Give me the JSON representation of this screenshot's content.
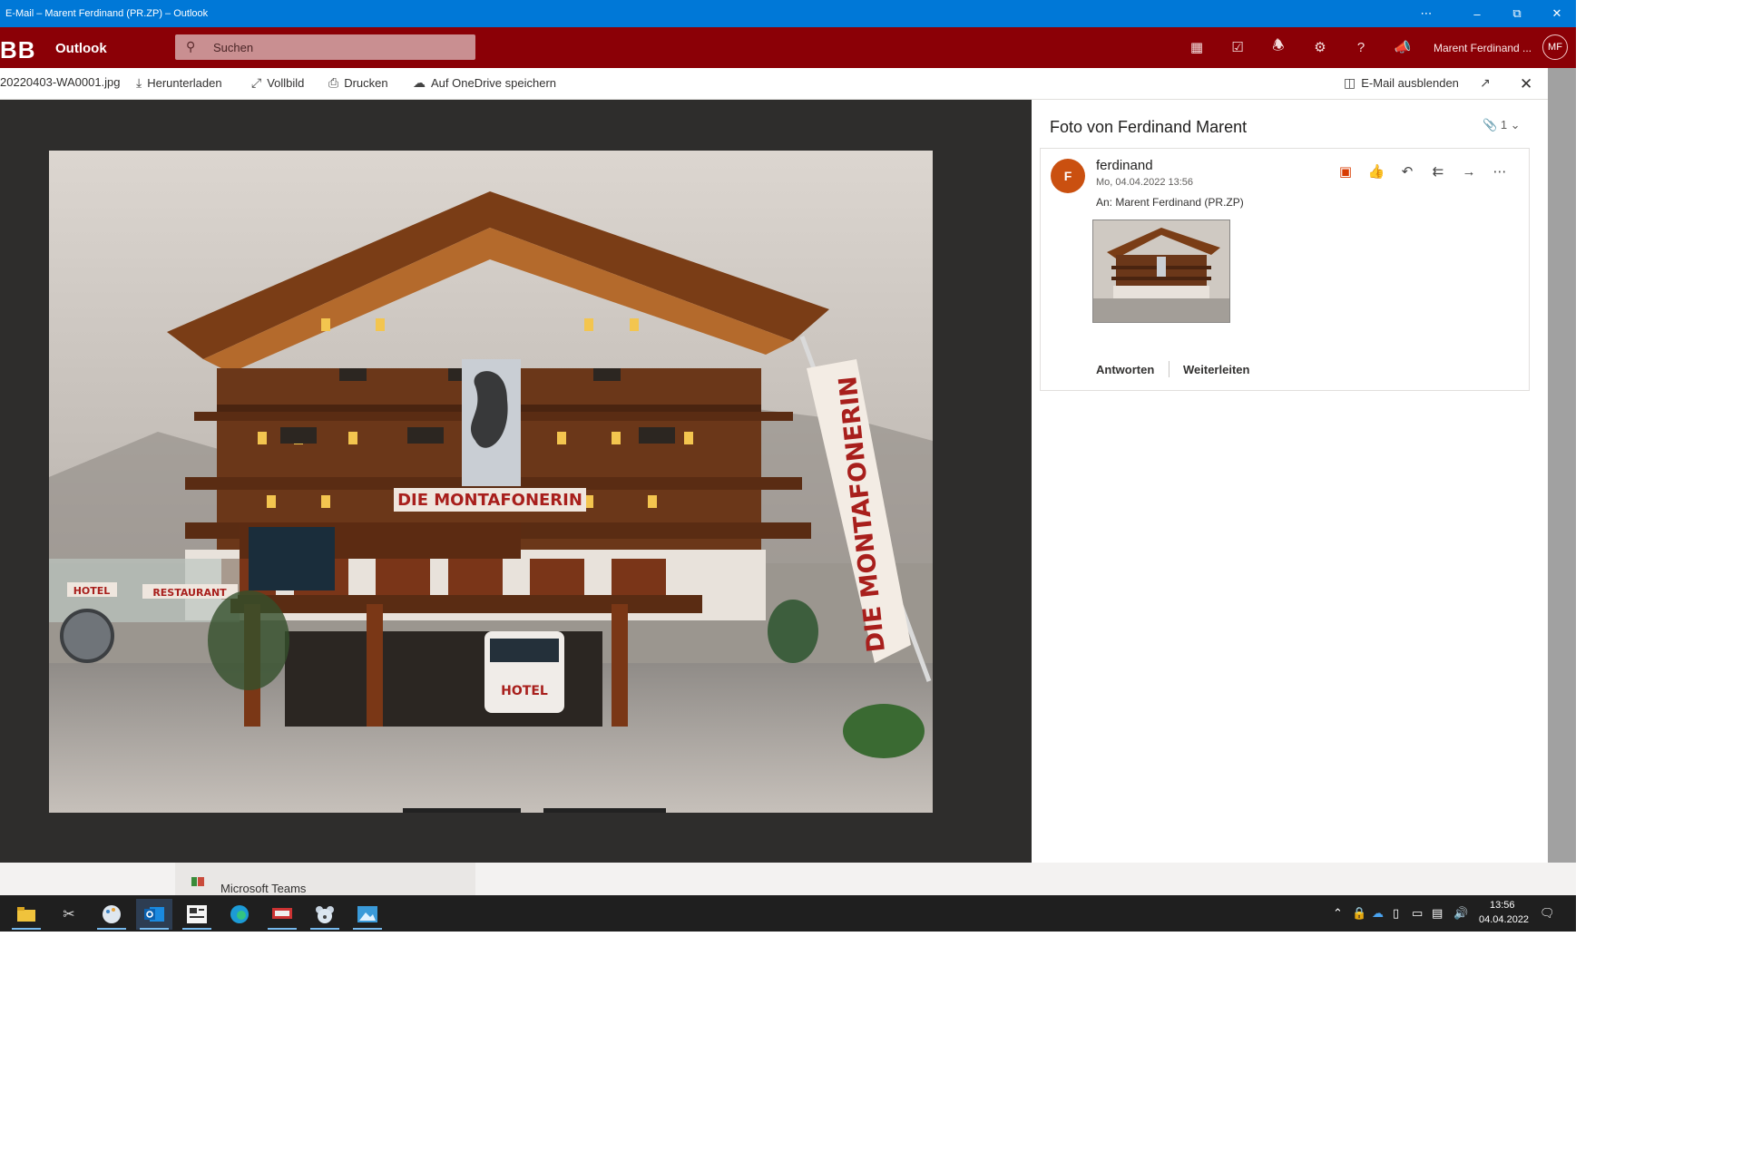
{
  "window": {
    "title": "E-Mail – Marent Ferdinand (PR.ZP) – Outlook",
    "controls": [
      "⋯",
      "–",
      "⧉",
      "✕"
    ]
  },
  "app": {
    "logo": "BB",
    "name": "Outlook",
    "search_placeholder": "Suchen",
    "user_name": "Marent Ferdinand ...",
    "user_initials": "MF",
    "brand_color": "#8b0006"
  },
  "viewer": {
    "filename": "20220403-WA0001.jpg",
    "actions": {
      "download": "Herunterladen",
      "fullscreen": "Vollbild",
      "print": "Drucken",
      "onedrive": "Auf OneDrive speichern",
      "hide_mail": "E-Mail ausblenden"
    }
  },
  "photo": {
    "sign": "DIE MONTAFONERIN",
    "banner": "DIE MONTAFONERIN",
    "hotel_left": "HOTEL",
    "restaurant": "RESTAURANT",
    "hotel_van": "HOTEL"
  },
  "message": {
    "subject": "Foto von Ferdinand Marent",
    "attachment_count": "1",
    "sender": "ferdinand",
    "sender_initial": "F",
    "date": "Mo, 04.04.2022 13:56",
    "to": "An: Marent Ferdinand (PR.ZP)",
    "reply": "Antworten",
    "forward": "Weiterleiten",
    "avatar_color": "#ca5010"
  },
  "behind": {
    "teams_label": "Microsoft Teams"
  },
  "taskbar": {
    "time": "13:56",
    "date": "04.04.2022"
  }
}
